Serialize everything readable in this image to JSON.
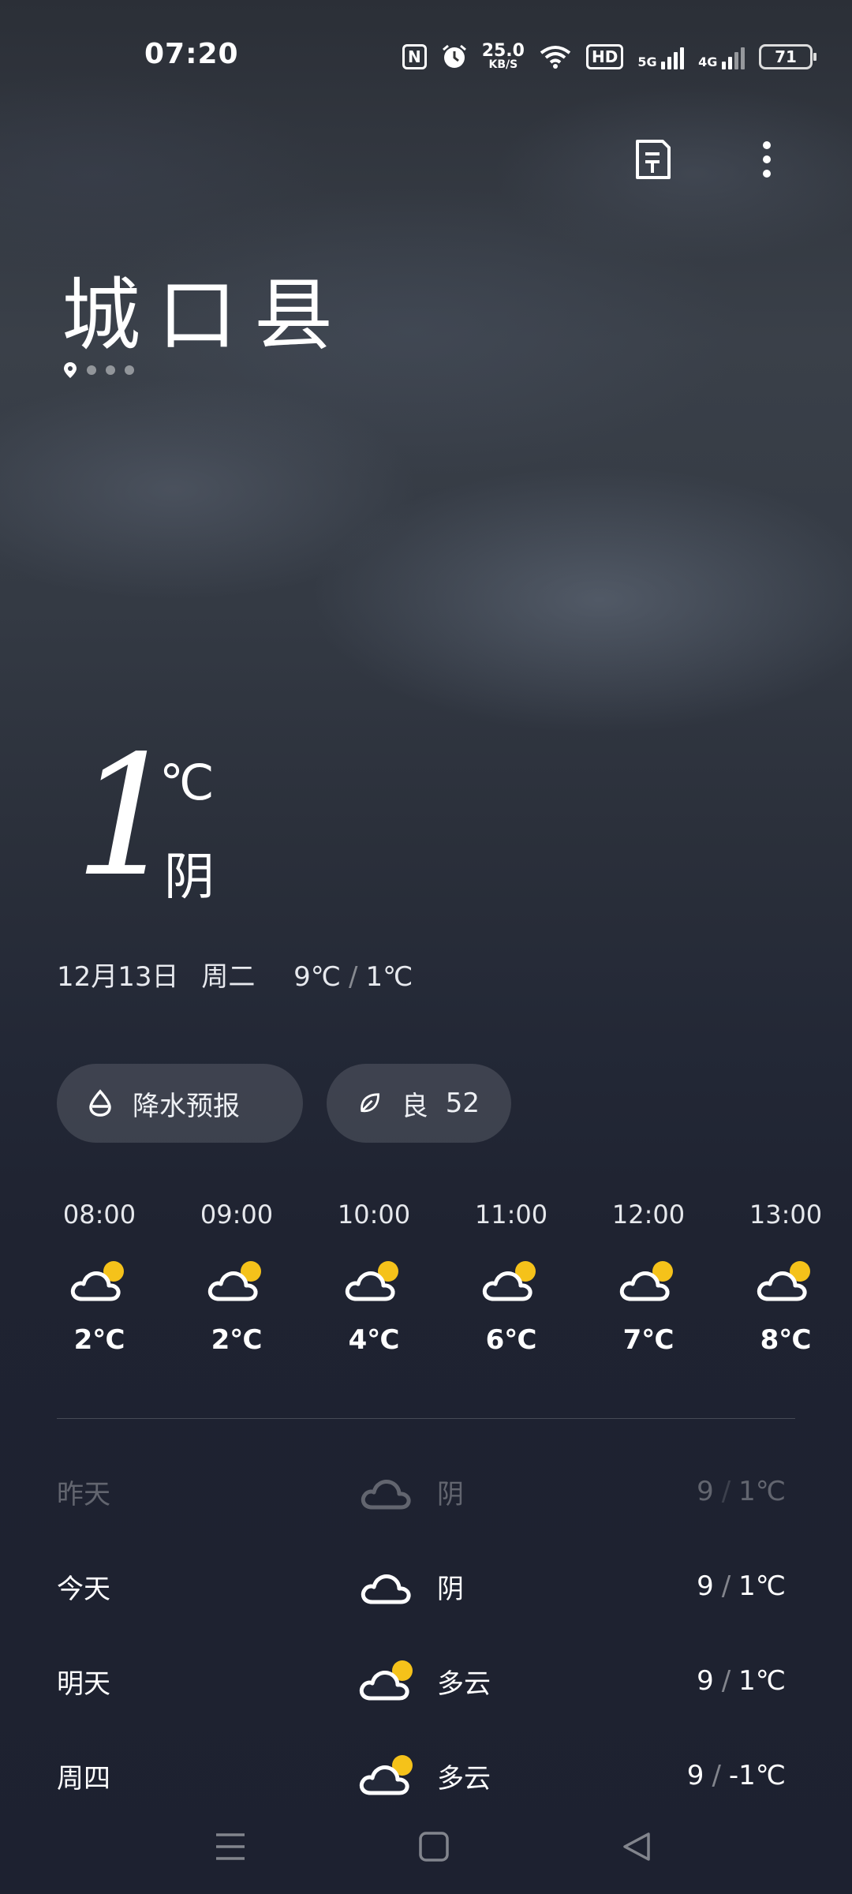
{
  "status_bar": {
    "time": "07:20",
    "nfc_label": "N",
    "speed_value": "25.0",
    "speed_unit": "KB/S",
    "hd_label": "HD",
    "net1_label": "5G",
    "net2_label": "4G",
    "battery": "71"
  },
  "header": {
    "city": "城口县",
    "page_count": 4,
    "active_page": 0
  },
  "current": {
    "temperature": "1",
    "unit": "℃",
    "condition": "阴",
    "date": "12月13日",
    "weekday": "周二",
    "high": "9℃",
    "separator": "/",
    "low": "1℃"
  },
  "chips": {
    "precipitation": "降水预报",
    "aqi_label": "良",
    "aqi_value": "52"
  },
  "hourly": [
    {
      "time": "08:00",
      "temp": "2℃",
      "icon": "partly-cloudy-icon"
    },
    {
      "time": "09:00",
      "temp": "2℃",
      "icon": "partly-cloudy-icon"
    },
    {
      "time": "10:00",
      "temp": "4℃",
      "icon": "partly-cloudy-icon"
    },
    {
      "time": "11:00",
      "temp": "6℃",
      "icon": "partly-cloudy-icon"
    },
    {
      "time": "12:00",
      "temp": "7℃",
      "icon": "partly-cloudy-icon"
    },
    {
      "time": "13:00",
      "temp": "8℃",
      "icon": "partly-cloudy-icon"
    }
  ],
  "daily": [
    {
      "day": "昨天",
      "icon": "cloud-icon",
      "condition": "阴",
      "high": "9",
      "separator": "/",
      "low": "1℃"
    },
    {
      "day": "今天",
      "icon": "cloud-icon",
      "condition": "阴",
      "high": "9",
      "separator": "/",
      "low": "1℃"
    },
    {
      "day": "明天",
      "icon": "partly-cloudy-icon",
      "condition": "多云",
      "high": "9",
      "separator": "/",
      "low": "1℃"
    },
    {
      "day": "周四",
      "icon": "partly-cloudy-icon",
      "condition": "多云",
      "high": "9",
      "separator": "/",
      "low": "-1℃"
    }
  ],
  "colors": {
    "sun": "#f5c21a",
    "chip_bg": "rgba(255,255,255,0.13)"
  }
}
